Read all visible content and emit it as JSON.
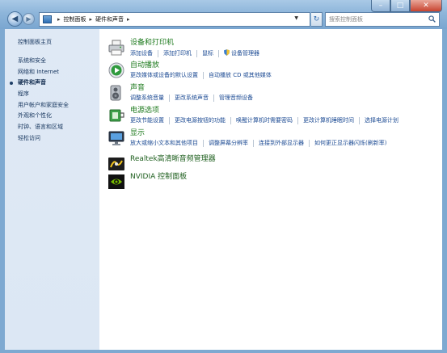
{
  "address_bar": {
    "crumbs": [
      "控制面板",
      "硬件和声音"
    ],
    "separator": "▸"
  },
  "search": {
    "placeholder": "搜索控制面板"
  },
  "window_buttons": {
    "minimize": "–",
    "maximize": "□",
    "close": "✕"
  },
  "sidebar": {
    "home": "控制面板主页",
    "items": [
      {
        "label": "系统和安全",
        "active": false
      },
      {
        "label": "网络和 Internet",
        "active": false
      },
      {
        "label": "硬件和声音",
        "active": true
      },
      {
        "label": "程序",
        "active": false
      },
      {
        "label": "用户帐户和家庭安全",
        "active": false
      },
      {
        "label": "外观和个性化",
        "active": false
      },
      {
        "label": "时钟、语言和区域",
        "active": false
      },
      {
        "label": "轻松访问",
        "active": false
      }
    ]
  },
  "categories": [
    {
      "title": "设备和打印机",
      "icon": "printer-icon",
      "links": [
        "添加设备",
        "添加打印机",
        "鼠标",
        "设备管理器"
      ]
    },
    {
      "title": "自动播放",
      "icon": "autoplay-icon",
      "links": [
        "更改媒体或设备的默认设置",
        "自动播放 CD 或其他媒体"
      ]
    },
    {
      "title": "声音",
      "icon": "speaker-icon",
      "links": [
        "调整系统音量",
        "更改系统声音",
        "管理音频设备"
      ]
    },
    {
      "title": "电源选项",
      "icon": "power-icon",
      "links": [
        "更改节能设置",
        "更改电源按钮的功能",
        "唤醒计算机时需要密码",
        "更改计算机睡眠时间",
        "选择电源计划"
      ]
    },
    {
      "title": "显示",
      "icon": "display-icon",
      "links": [
        "放大或缩小文本和其他项目",
        "调整屏幕分辨率",
        "连接到外部显示器",
        "如何更正显示器闪烁(刷新率)"
      ]
    },
    {
      "title": "Realtek高清晰音频管理器",
      "icon": "realtek-icon",
      "links": []
    },
    {
      "title": "NVIDIA 控制面板",
      "icon": "nvidia-icon",
      "links": []
    }
  ],
  "colors": {
    "category_title": "#1e7a1e",
    "link": "#1b4a93",
    "sidebar_text": "#14335c",
    "sidebar_bg": "#dfe9f5",
    "frame": "#7ea9d1"
  }
}
